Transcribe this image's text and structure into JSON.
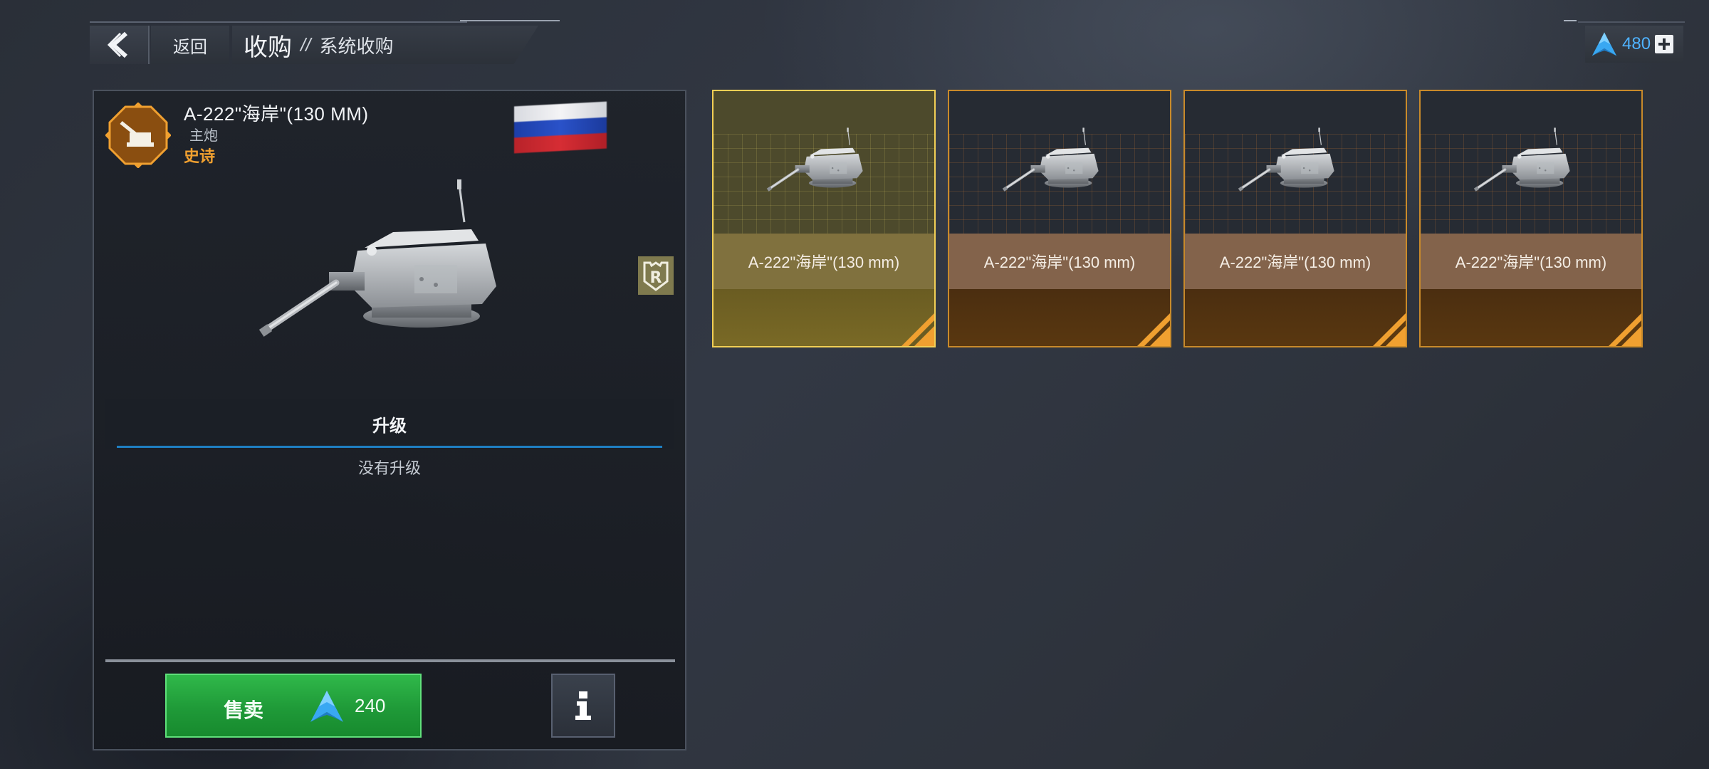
{
  "header": {
    "back_label": "返回",
    "title": "收购",
    "separator": "//",
    "subtitle": "系统收购"
  },
  "currency": {
    "amount": "480",
    "icon": "currency-a-icon",
    "accent": "#4fb3ff"
  },
  "item": {
    "name": "A-222\"海岸\"(130 MM)",
    "type": "主炮",
    "rarity": "史诗",
    "rarity_color": "#f0a030",
    "flag": "russia-flag",
    "badge_icon": "r-badge-icon"
  },
  "upgrades": {
    "tab_label": "升级",
    "empty_text": "没有升级"
  },
  "actions": {
    "sell_label": "售卖",
    "sell_price": "240",
    "info_icon": "info-icon"
  },
  "cards": [
    {
      "label": "A-222\"海岸\"(130 mm)",
      "selected": true
    },
    {
      "label": "A-222\"海岸\"(130 mm)",
      "selected": false
    },
    {
      "label": "A-222\"海岸\"(130 mm)",
      "selected": false
    },
    {
      "label": "A-222\"海岸\"(130 mm)",
      "selected": false
    }
  ],
  "colors": {
    "rarity_epic": "#c98a2a",
    "selected": "#f2cf55",
    "sell_green": "#1f9a38"
  }
}
